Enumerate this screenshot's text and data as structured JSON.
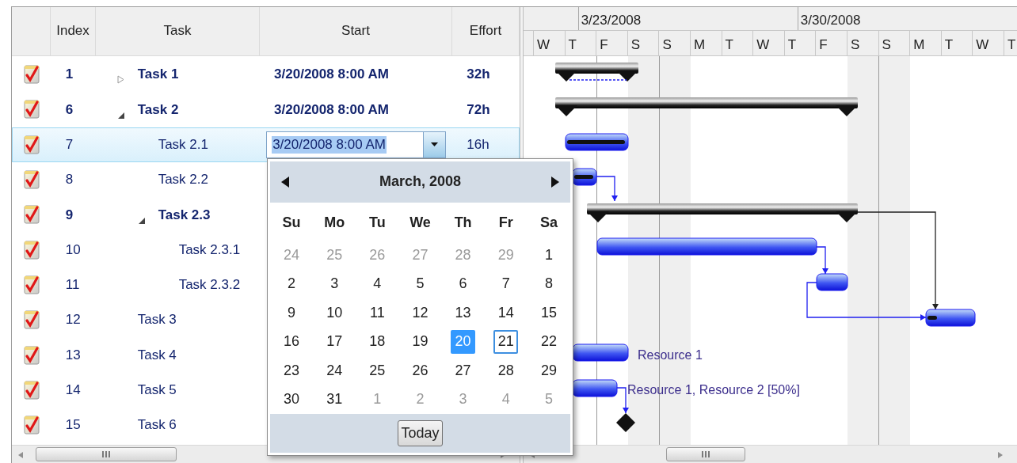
{
  "grid": {
    "columns": [
      "Index",
      "Task",
      "Start",
      "Effort"
    ],
    "rows": [
      {
        "index": "1",
        "task": "Task 1",
        "start": "3/20/2008 8:00 AM",
        "effort": "32h",
        "summary": true,
        "expanded": false,
        "selected": false,
        "editing": false
      },
      {
        "index": "6",
        "task": "Task 2",
        "start": "3/20/2008 8:00 AM",
        "effort": "72h",
        "summary": true,
        "expanded": true,
        "selected": false,
        "editing": false,
        "children": [
          {
            "index": "7",
            "task": "Task 2.1",
            "start": "3/20/2008 8:00 AM",
            "effort": "16h",
            "summary": false,
            "selected": true,
            "editing": true
          },
          {
            "index": "8",
            "task": "Task 2.2",
            "summary": false,
            "selected": false,
            "editing": false
          },
          {
            "index": "9",
            "task": "Task 2.3",
            "summary": true,
            "expanded": true,
            "selected": false,
            "editing": false,
            "children": [
              {
                "index": "10",
                "task": "Task 2.3.1",
                "summary": false,
                "selected": false,
                "editing": false
              },
              {
                "index": "11",
                "task": "Task 2.3.2",
                "summary": false,
                "selected": false,
                "editing": false
              }
            ]
          }
        ]
      },
      {
        "index": "12",
        "task": "Task 3",
        "summary": false,
        "selected": false,
        "editing": false
      },
      {
        "index": "13",
        "task": "Task 4",
        "summary": false,
        "selected": false,
        "editing": false
      },
      {
        "index": "14",
        "task": "Task 5",
        "summary": false,
        "selected": false,
        "editing": false
      },
      {
        "index": "15",
        "task": "Task 6",
        "summary": false,
        "selected": false,
        "editing": false
      }
    ]
  },
  "timeline": {
    "weeks": [
      "3/23/2008",
      "3/30/2008"
    ],
    "days": [
      "W",
      "T",
      "F",
      "S",
      "S",
      "M",
      "T",
      "W",
      "T",
      "F",
      "S",
      "S",
      "M",
      "T",
      "W",
      "T"
    ],
    "bar_labels": [
      "Resource 1",
      "Resource 1, Resource 2 [50%]"
    ]
  },
  "calendar": {
    "title": "March, 2008",
    "day_names": [
      "Su",
      "Mo",
      "Tu",
      "We",
      "Th",
      "Fr",
      "Sa"
    ],
    "weeks": [
      [
        {
          "day": "24",
          "other_month": true,
          "selected": false,
          "today": false
        },
        {
          "day": "25",
          "other_month": true,
          "selected": false,
          "today": false
        },
        {
          "day": "26",
          "other_month": true,
          "selected": false,
          "today": false
        },
        {
          "day": "27",
          "other_month": true,
          "selected": false,
          "today": false
        },
        {
          "day": "28",
          "other_month": true,
          "selected": false,
          "today": false
        },
        {
          "day": "29",
          "other_month": true,
          "selected": false,
          "today": false
        },
        {
          "day": "1",
          "other_month": false,
          "selected": false,
          "today": false
        }
      ],
      [
        {
          "day": "2",
          "other_month": false,
          "selected": false,
          "today": false
        },
        {
          "day": "3",
          "other_month": false,
          "selected": false,
          "today": false
        },
        {
          "day": "4",
          "other_month": false,
          "selected": false,
          "today": false
        },
        {
          "day": "5",
          "other_month": false,
          "selected": false,
          "today": false
        },
        {
          "day": "6",
          "other_month": false,
          "selected": false,
          "today": false
        },
        {
          "day": "7",
          "other_month": false,
          "selected": false,
          "today": false
        },
        {
          "day": "8",
          "other_month": false,
          "selected": false,
          "today": false
        }
      ],
      [
        {
          "day": "9",
          "other_month": false,
          "selected": false,
          "today": false
        },
        {
          "day": "10",
          "other_month": false,
          "selected": false,
          "today": false
        },
        {
          "day": "11",
          "other_month": false,
          "selected": false,
          "today": false
        },
        {
          "day": "12",
          "other_month": false,
          "selected": false,
          "today": false
        },
        {
          "day": "13",
          "other_month": false,
          "selected": false,
          "today": false
        },
        {
          "day": "14",
          "other_month": false,
          "selected": false,
          "today": false
        },
        {
          "day": "15",
          "other_month": false,
          "selected": false,
          "today": false
        }
      ],
      [
        {
          "day": "16",
          "other_month": false,
          "selected": false,
          "today": false
        },
        {
          "day": "17",
          "other_month": false,
          "selected": false,
          "today": false
        },
        {
          "day": "18",
          "other_month": false,
          "selected": false,
          "today": false
        },
        {
          "day": "19",
          "other_month": false,
          "selected": false,
          "today": false
        },
        {
          "day": "20",
          "other_month": false,
          "selected": true,
          "today": false
        },
        {
          "day": "21",
          "other_month": false,
          "selected": false,
          "today": true
        },
        {
          "day": "22",
          "other_month": false,
          "selected": false,
          "today": false
        }
      ],
      [
        {
          "day": "23",
          "other_month": false,
          "selected": false,
          "today": false
        },
        {
          "day": "24",
          "other_month": false,
          "selected": false,
          "today": false
        },
        {
          "day": "25",
          "other_month": false,
          "selected": false,
          "today": false
        },
        {
          "day": "26",
          "other_month": false,
          "selected": false,
          "today": false
        },
        {
          "day": "27",
          "other_month": false,
          "selected": false,
          "today": false
        },
        {
          "day": "28",
          "other_month": false,
          "selected": false,
          "today": false
        },
        {
          "day": "29",
          "other_month": false,
          "selected": false,
          "today": false
        }
      ],
      [
        {
          "day": "30",
          "other_month": false,
          "selected": false,
          "today": false
        },
        {
          "day": "31",
          "other_month": false,
          "selected": false,
          "today": false
        },
        {
          "day": "1",
          "other_month": true,
          "selected": false,
          "today": false
        },
        {
          "day": "2",
          "other_month": true,
          "selected": false,
          "today": false
        },
        {
          "day": "3",
          "other_month": true,
          "selected": false,
          "today": false
        },
        {
          "day": "4",
          "other_month": true,
          "selected": false,
          "today": false
        },
        {
          "day": "5",
          "other_month": true,
          "selected": false,
          "today": false
        }
      ]
    ],
    "today_button": "Today"
  }
}
